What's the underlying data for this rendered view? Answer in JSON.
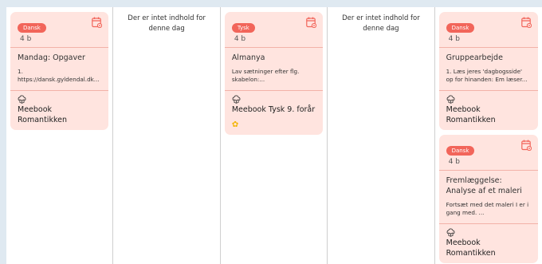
{
  "columns": [
    {
      "cards": [
        {
          "subject": "Dansk",
          "class_name": "4 b",
          "title": "Mandag: Opgaver",
          "description": "1. https://dansk.gyldendal.dk...",
          "source": "Meebook Romantikken"
        }
      ]
    },
    {
      "empty_text": "Der er intet indhold for denne dag"
    },
    {
      "cards": [
        {
          "subject": "Tysk",
          "class_name": "4 b",
          "title": "Almanya",
          "description": "Lav sætninger efter flg. skabelon:...",
          "source": "Meebook Tysk 9. forår"
        }
      ]
    },
    {
      "empty_text": "Der er intet indhold for denne dag"
    },
    {
      "cards": [
        {
          "subject": "Dansk",
          "class_name": "4 b",
          "title": "Gruppearbejde",
          "description": "1. Læs jeres 'dagbogsside' op for hinanden: Em læser...",
          "source": "Meebook Romantikken"
        },
        {
          "subject": "Dansk",
          "class_name": "4 b",
          "title": "Fremlæggelse: Analyse af et maleri",
          "description": "Fortsæt med det maleri I er i gang med. ...",
          "source": "Meebook Romantikken"
        }
      ]
    }
  ],
  "colors": {
    "card_bg": "#ffe4df",
    "pill": "#f2655a",
    "divider": "#f3b2a8",
    "page_bg": "#dfe9f1"
  },
  "icons": {
    "calendar": "calendar-icon",
    "source": "cloud-book-icon",
    "emoji": "sunflower-icon"
  }
}
